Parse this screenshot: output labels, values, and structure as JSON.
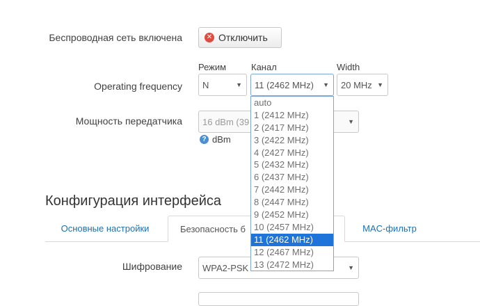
{
  "wireless": {
    "enabled_label": "Беспроводная сеть включена",
    "disable_button": "Отключить"
  },
  "frequency": {
    "label": "Operating frequency",
    "mode_header": "Режим",
    "channel_header": "Канал",
    "width_header": "Width",
    "mode_value": "N",
    "channel_value": "11 (2462 MHz)",
    "width_value": "20 MHz",
    "channel_options": [
      "auto",
      "1 (2412 MHz)",
      "2 (2417 MHz)",
      "3 (2422 MHz)",
      "4 (2427 MHz)",
      "5 (2432 MHz)",
      "6 (2437 MHz)",
      "7 (2442 MHz)",
      "8 (2447 MHz)",
      "9 (2452 MHz)",
      "10 (2457 MHz)",
      "11 (2462 MHz)",
      "12 (2467 MHz)",
      "13 (2472 MHz)"
    ],
    "selected_index": 11
  },
  "txpower": {
    "label": "Мощность передатчика",
    "value": "16 dBm (39",
    "unit_hint": "dBm"
  },
  "interface_config": {
    "title": "Конфигурация интерфейса",
    "tabs": [
      "Основные настройки",
      "Безопасность б",
      "MAC-фильтр"
    ],
    "encryption_label": "Шифрование",
    "encryption_value": "WPA2-PSK"
  },
  "colors": {
    "accent": "#1e74d8",
    "link": "#1f6fb2",
    "danger": "#e04a3f"
  }
}
